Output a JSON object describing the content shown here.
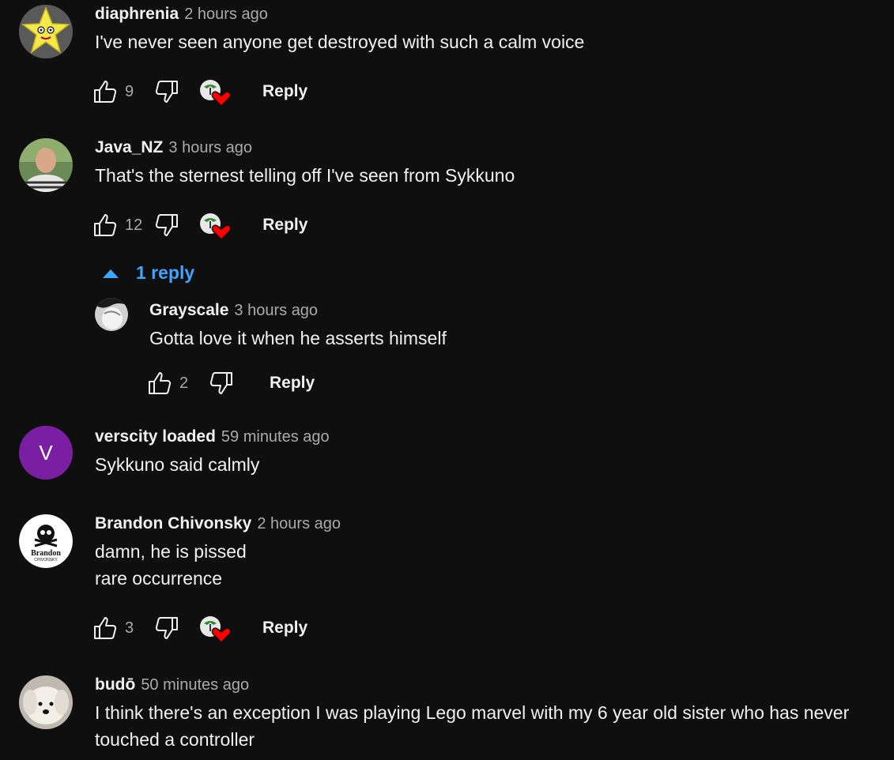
{
  "comments": [
    {
      "author": "diaphrenia",
      "time": "2 hours ago",
      "text": [
        "I've never seen anyone get destroyed with such a calm voice"
      ],
      "likes": "9",
      "reply_label": "Reply"
    },
    {
      "author": "Java_NZ",
      "time": "3 hours ago",
      "text": [
        "That's the sternest telling off I've seen from Sykkuno"
      ],
      "likes": "12",
      "reply_label": "Reply",
      "replies_toggle": "1 reply"
    },
    {
      "author": "Grayscale",
      "time": "3 hours ago",
      "text": [
        "Gotta love it when he asserts himself"
      ],
      "likes": "2",
      "reply_label": "Reply"
    },
    {
      "author": "verscity loaded",
      "time": "59 minutes ago",
      "text": [
        "Sykkuno said calmly"
      ],
      "avatar_letter": "V",
      "avatar_color": "#7b1fa2"
    },
    {
      "author": "Brandon Chivonsky",
      "time": "2 hours ago",
      "text": [
        "damn, he is pissed",
        "rare occurrence"
      ],
      "likes": "3",
      "reply_label": "Reply",
      "avatar_logo_text": [
        "Brandon",
        "CHIVONSKY"
      ]
    },
    {
      "author": "budō",
      "time": "50 minutes ago",
      "text": [
        "I think there's an exception I was playing Lego marvel with my 6 year old sister who has never",
        "touched a controller"
      ]
    }
  ],
  "colors": {
    "background": "#0f0f0f",
    "link_blue": "#3ea6ff",
    "heart_red": "#ff0000",
    "muted_text": "#aaaaaa"
  }
}
